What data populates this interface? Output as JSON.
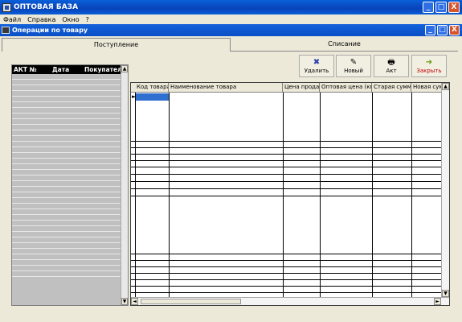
{
  "window": {
    "title": "ОПТОВАЯ БАЗА",
    "controls": [
      "_",
      "□",
      "X"
    ]
  },
  "menu": [
    "Файл",
    "Справка",
    "Окно",
    "?"
  ],
  "child_window": {
    "title": "Операции по товару",
    "controls": [
      "_",
      "□",
      "X"
    ]
  },
  "tabs": [
    {
      "label": "Поступление",
      "active": true
    },
    {
      "label": "Списание",
      "active": false
    }
  ],
  "left_grid": {
    "columns": [
      "АКТ №",
      "Дата",
      "Покупатель"
    ],
    "scroll_up": "▲",
    "scroll_down": "▼"
  },
  "toolbar": [
    {
      "label": "Удалить",
      "icon": "delete-icon",
      "glyph": "✖"
    },
    {
      "label": "Новый",
      "icon": "new-icon",
      "glyph": "✎"
    },
    {
      "label": "Акт",
      "icon": "printer-icon",
      "glyph": "🖶"
    },
    {
      "label": "Закрыть",
      "icon": "door-exit-icon",
      "glyph": "➜"
    }
  ],
  "main_grid": {
    "columns": [
      "Код товара",
      "Наименование товара",
      "Цена продаж",
      "Оптовая цена (кг.",
      "Старая сумма",
      "Новая сумм"
    ],
    "row_marker": "►",
    "scroll_up": "▲",
    "scroll_down": "▼",
    "scroll_left": "◄",
    "scroll_right": "►"
  }
}
